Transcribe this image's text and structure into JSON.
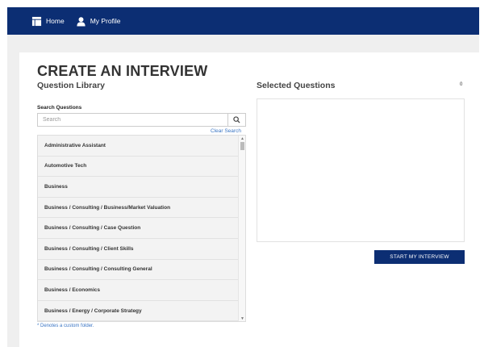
{
  "nav": {
    "items": [
      {
        "label": "Home",
        "icon": "table-icon"
      },
      {
        "label": "My Profile",
        "icon": "user-icon"
      }
    ]
  },
  "page": {
    "title": "CREATE AN INTERVIEW"
  },
  "library": {
    "heading": "Question Library",
    "search_label": "Search Questions",
    "search_placeholder": "Search",
    "search_icon": "search-icon",
    "clear_label": "Clear Search",
    "items": [
      "Administrative Assistant",
      "Automotive Tech",
      "Business",
      "Business / Consulting / Business/Market Valuation",
      "Business / Consulting / Case Question",
      "Business / Consulting / Client Skills",
      "Business / Consulting / Consulting General",
      "Business / Economics",
      "Business / Energy / Corporate Strategy"
    ],
    "footnote": "* Denotes a custom folder."
  },
  "selected": {
    "heading": "Selected Questions",
    "count": "0",
    "start_label": "START MY INTERVIEW"
  },
  "colors": {
    "navbar": "#0c2e73",
    "link": "#3a75c4",
    "button": "#0c2e73"
  }
}
